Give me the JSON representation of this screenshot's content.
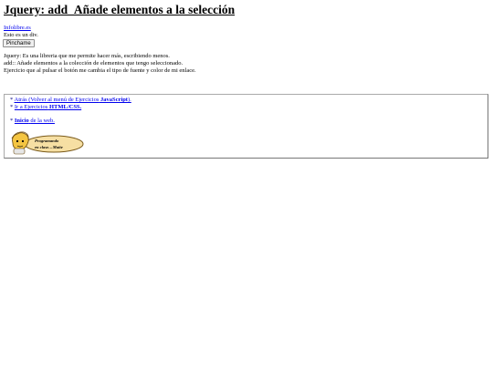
{
  "page": {
    "title": "Jquery: add_Añade elementos a la selección",
    "site_link": "Infolibre.es",
    "div_text": "Esto es un div.",
    "button_label": "Pinchame"
  },
  "description": {
    "line1": "Jquery: Es una libreria que me permite hacer más, escribiendo menos.",
    "line2": "add:: Añade elementos a la colección de elementos que tengo seleccionado.",
    "line3": "Ejercicio que al pulsar el botón me cambia el tipo de fuente y color de mi enlace."
  },
  "nav": {
    "star": "*",
    "back_text": "Atrás (Volver al menú de Ejercicios",
    "back_bold": "JavaScript",
    "back_end": ").",
    "exercises_text": "Ir a Ejercicios",
    "exercises_bold": "HTML/CSS.",
    "home_bold": "Inicio",
    "home_text": "de la web."
  },
  "badge": {
    "line1": "Programando",
    "line2": "en clase…Maite"
  },
  "colors": {
    "link": "#0000ee",
    "nav_text": "#000080",
    "badge_fill": "#f6dfa3",
    "badge_stroke": "#7a5a1a"
  },
  "icons": [
    "person-cartoon-icon"
  ]
}
